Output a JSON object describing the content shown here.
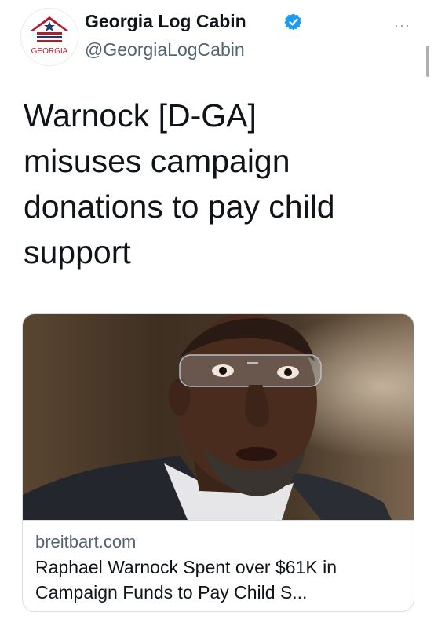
{
  "account": {
    "display_name": "Georgia Log Cabin",
    "handle": "@GeorgiaLogCabin",
    "avatar_text": "GEORGIA",
    "verified": true
  },
  "menu": {
    "more_label": "···"
  },
  "tweet": {
    "text": "Warnock [D-GA]\nmisuses campaign\ndonations to pay child\nsupport"
  },
  "link_card": {
    "domain": "breitbart.com",
    "title": "Raphael Warnock Spent over $61K in Campaign Funds to Pay Child S..."
  },
  "colors": {
    "verified_badge": "#1d9bf0",
    "brand_red": "#b01c2e",
    "brand_blue": "#1f3a6e"
  }
}
